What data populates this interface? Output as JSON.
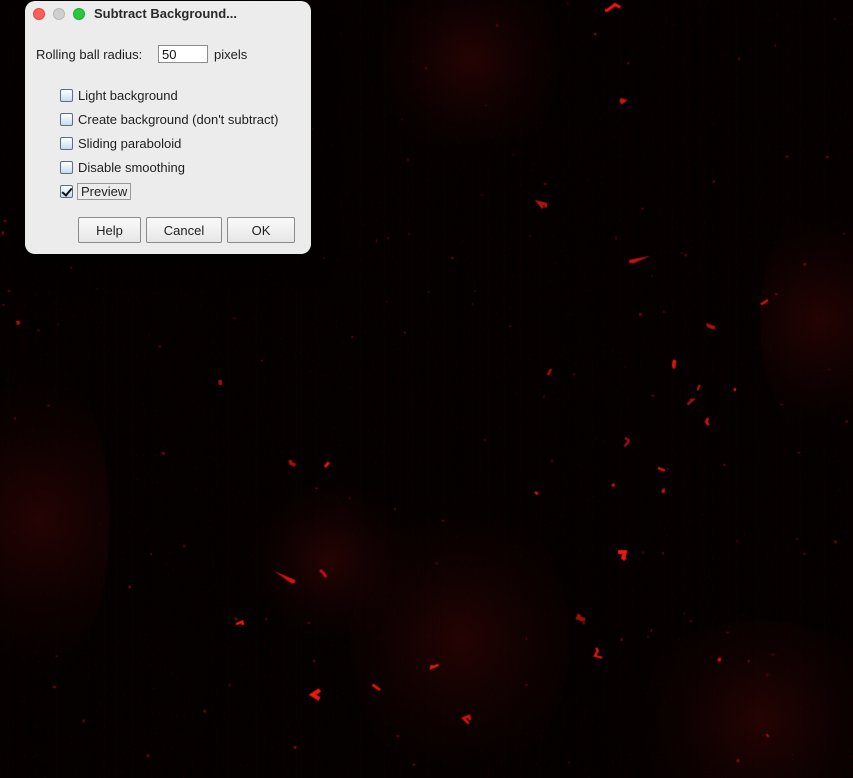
{
  "dialog": {
    "title": "Subtract Background...",
    "radius_label": "Rolling ball radius:",
    "radius_value": "50",
    "radius_unit": "pixels",
    "options": [
      {
        "label": "Light background",
        "checked": false
      },
      {
        "label": "Create background (don't subtract)",
        "checked": false
      },
      {
        "label": "Sliding paraboloid",
        "checked": false
      },
      {
        "label": "Disable smoothing",
        "checked": false
      },
      {
        "label": "Preview",
        "checked": true
      }
    ],
    "buttons": {
      "help": "Help",
      "cancel": "Cancel",
      "ok": "OK"
    }
  },
  "colors": {
    "image_background": "#050101",
    "signal": "#ff1a10",
    "dialog_background": "#ececec",
    "close": "#fe5f57",
    "zoom": "#28c840"
  }
}
